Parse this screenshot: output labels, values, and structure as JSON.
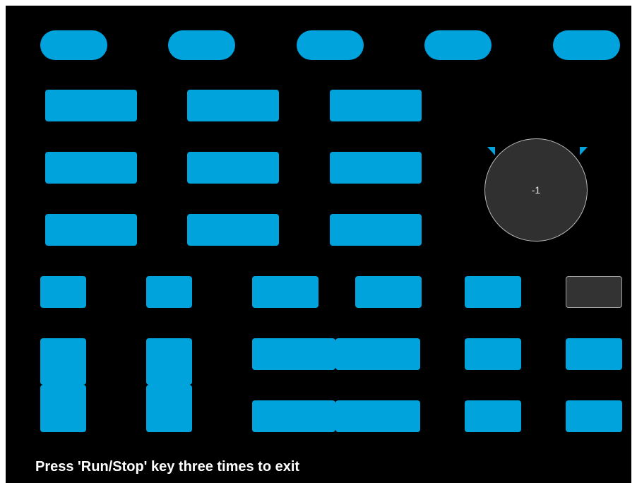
{
  "knob": {
    "value": "-1"
  },
  "footer": {
    "exit_message": "Press 'Run/Stop' key three times to exit"
  },
  "colors": {
    "key_active": "#00a3dc",
    "key_inactive": "#333333",
    "background": "#000000",
    "text": "#ffffff"
  },
  "icons": {
    "knob_rotate_left": "triangle-indicator",
    "knob_rotate_right": "triangle-indicator"
  }
}
